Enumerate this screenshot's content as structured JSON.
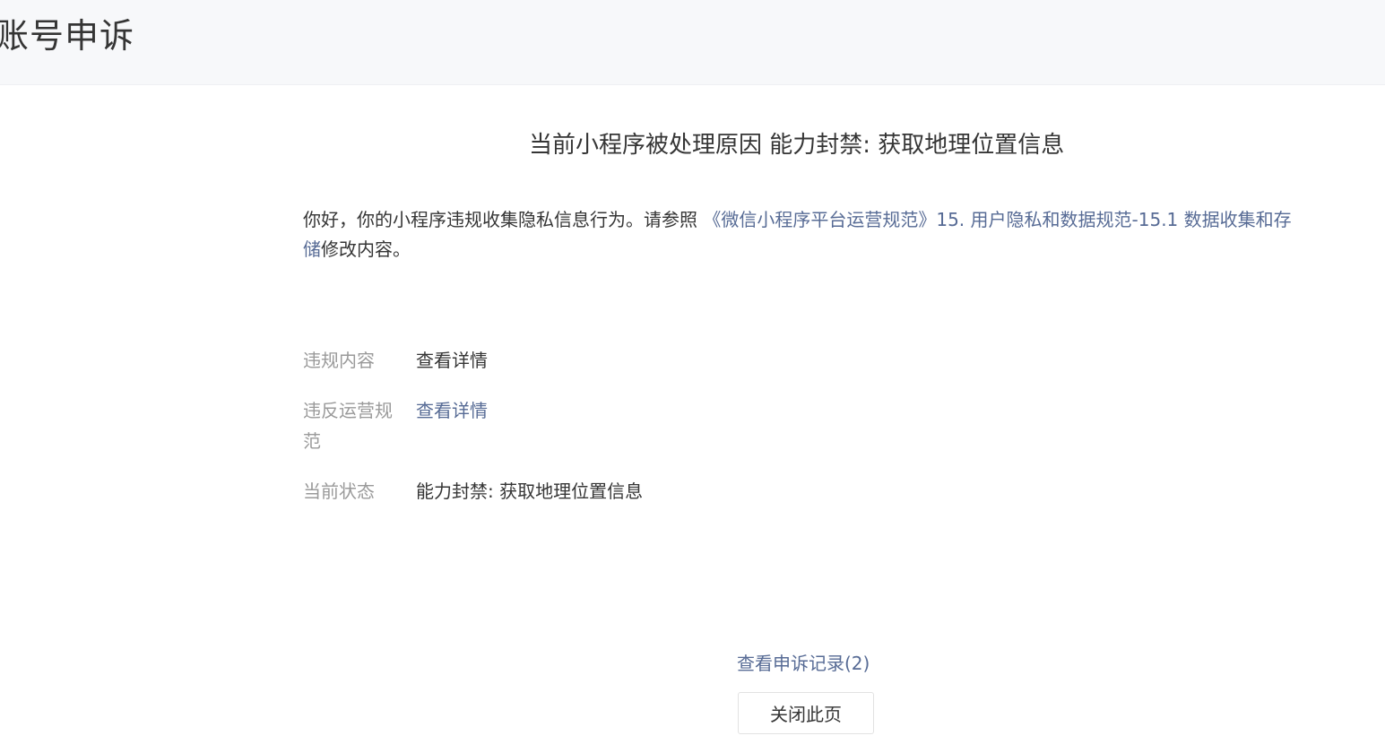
{
  "header": {
    "title": "账号申诉"
  },
  "main": {
    "heading": "当前小程序被处理原因 能力封禁: 获取地理位置信息",
    "intro": {
      "prefix": "你好，你的小程序违规收集隐私信息行为。请参照 ",
      "link_text": "《微信小程序平台运营规范》15. 用户隐私和数据规范-15.1 数据收集和存储",
      "suffix": "修改内容。"
    },
    "details": [
      {
        "label": "违规内容",
        "value": "查看详情"
      },
      {
        "label": "违反运营规范",
        "value": "查看详情"
      },
      {
        "label": "当前状态",
        "value": "能力封禁: 获取地理位置信息"
      }
    ]
  },
  "footer": {
    "records_link": "查看申诉记录(2)",
    "close_button": "关闭此页"
  },
  "colors": {
    "link": "#576b95",
    "label": "#9a9a9a",
    "text": "#353535",
    "header_bg": "#f7f8fa"
  }
}
